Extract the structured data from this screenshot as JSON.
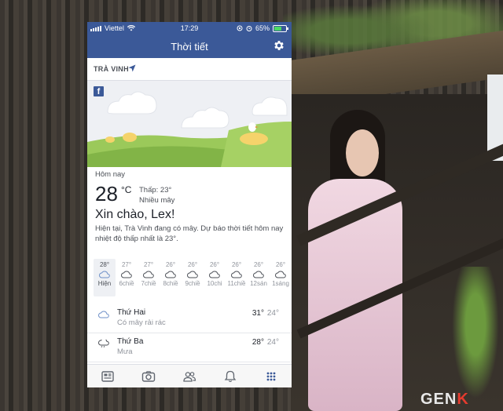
{
  "status_bar": {
    "carrier": "Viettel",
    "time": "17:29",
    "battery": "65%"
  },
  "app": {
    "title": "Thời tiết"
  },
  "location": {
    "name": "TRÀ VINH"
  },
  "current": {
    "label": "Hôm nay",
    "temp": "28",
    "unit": "°C",
    "low": "Thấp: 23°",
    "condition": "Nhiều mây",
    "greeting": "Xin chào, Lex!",
    "summary": "Hiện tại, Trà Vinh đang có mây. Dự báo thời tiết hôm nay nhiệt độ thấp nhất là 23°."
  },
  "hourly": [
    {
      "temp": "28°",
      "label": "Hiện",
      "icon": "cloud-icon"
    },
    {
      "temp": "27°",
      "label": "6chiề",
      "icon": "cloud-icon"
    },
    {
      "temp": "27°",
      "label": "7chiề",
      "icon": "cloud-icon"
    },
    {
      "temp": "26°",
      "label": "8chiề",
      "icon": "cloud-icon"
    },
    {
      "temp": "26°",
      "label": "9chiề",
      "icon": "cloud-icon"
    },
    {
      "temp": "26°",
      "label": "10chi",
      "icon": "cloud-icon"
    },
    {
      "temp": "26°",
      "label": "11chiề",
      "icon": "cloud-icon"
    },
    {
      "temp": "26°",
      "label": "12sán",
      "icon": "cloud-icon"
    },
    {
      "temp": "26°",
      "label": "1sáng",
      "icon": "cloud-icon"
    }
  ],
  "daily": [
    {
      "name": "Thứ Hai",
      "desc": "Có mây rải rác",
      "high": "31°",
      "low": "24°",
      "icon": "partly-cloudy-icon"
    },
    {
      "name": "Thứ Ba",
      "desc": "Mưa",
      "high": "28°",
      "low": "24°",
      "icon": "rain-icon"
    }
  ],
  "tabs": [
    "news-feed-icon",
    "camera-icon",
    "friends-icon",
    "bell-icon",
    "menu-icon"
  ],
  "colors": {
    "brand": "#3b5998",
    "grass": "#8dc04a",
    "sun": "#f5d36b"
  },
  "watermark": {
    "prefix": "GEN",
    "suffix": "K"
  }
}
